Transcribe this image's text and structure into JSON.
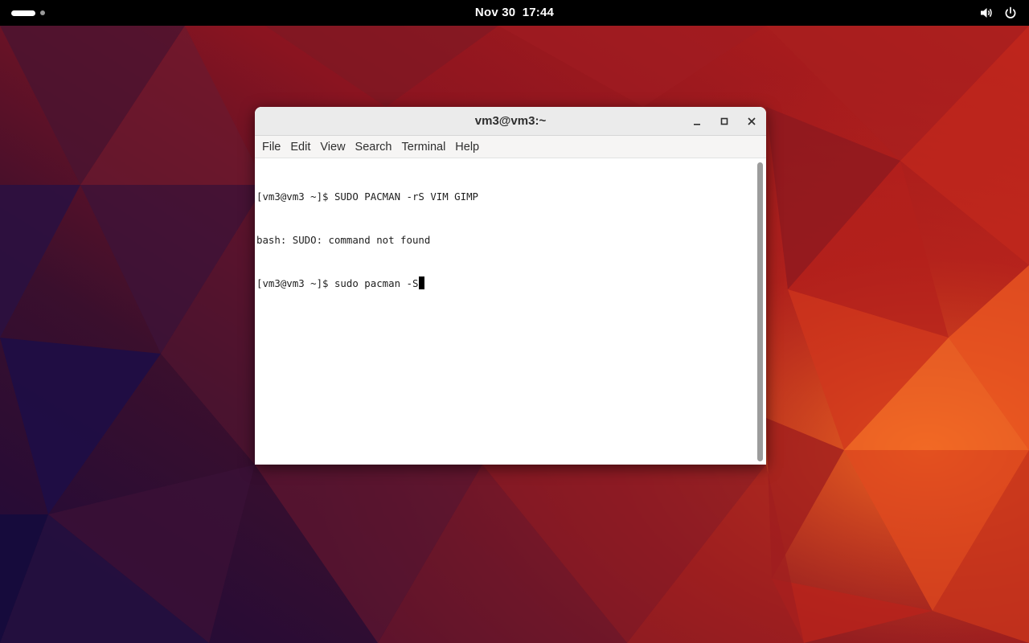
{
  "topbar": {
    "date": "Nov 30",
    "time": "17:44",
    "icons": [
      "activities-indicator",
      "volume-icon",
      "power-icon"
    ]
  },
  "window": {
    "title": "vm3@vm3:~",
    "controls": [
      "minimize-icon",
      "maximize-icon",
      "close-icon"
    ],
    "menu": [
      "File",
      "Edit",
      "View",
      "Search",
      "Terminal",
      "Help"
    ]
  },
  "terminal": {
    "lines": [
      "[vm3@vm3 ~]$ SUDO PACMAN -rS VIM GIMP",
      "bash: SUDO: command not found",
      "[vm3@vm3 ~]$ sudo pacman -S"
    ]
  },
  "colors": {
    "topbar": "#000000",
    "titlebar": "#ebebeb",
    "menubar": "#f6f5f4",
    "terminal_bg": "#ffffff",
    "terminal_fg": "#1e1e1e",
    "wallpaper_dark": "#2a0f2e",
    "wallpaper_red": "#b3171c",
    "wallpaper_orange": "#f05a20"
  }
}
